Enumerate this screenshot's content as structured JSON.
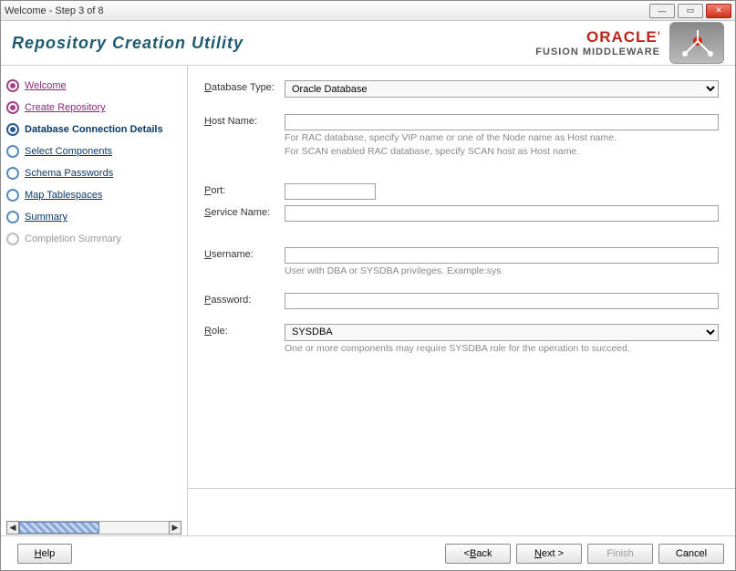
{
  "window": {
    "title": "Welcome - Step 3 of 8"
  },
  "header": {
    "title": "Repository Creation Utility",
    "brand": "ORACLE",
    "brand_sub": "FUSION MIDDLEWARE"
  },
  "steps": [
    {
      "label": "Welcome",
      "state": "done"
    },
    {
      "label": "Create Repository",
      "state": "done"
    },
    {
      "label": "Database Connection Details",
      "state": "current"
    },
    {
      "label": "Select Components",
      "state": "pending"
    },
    {
      "label": "Schema Passwords",
      "state": "pending"
    },
    {
      "label": "Map Tablespaces",
      "state": "pending"
    },
    {
      "label": "Summary",
      "state": "pending"
    },
    {
      "label": "Completion Summary",
      "state": "disabled"
    }
  ],
  "form": {
    "db_type_label": "Database Type:",
    "db_type_value": "Oracle Database",
    "host_label": "Host Name:",
    "host_value": "",
    "host_hint1": "For RAC database, specify VIP name or one of the Node name as Host name.",
    "host_hint2": "For SCAN enabled RAC database, specify SCAN host as Host name.",
    "port_label": "Port:",
    "port_value": "",
    "service_label": "Service Name:",
    "service_value": "",
    "username_label": "Username:",
    "username_value": "",
    "username_hint": "User with DBA or SYSDBA privileges. Example:sys",
    "password_label": "Password:",
    "password_value": "",
    "role_label": "Role:",
    "role_value": "SYSDBA",
    "role_hint": "One or more components may require SYSDBA role for the operation to succeed."
  },
  "buttons": {
    "help": "Help",
    "back": "Back",
    "next": "Next",
    "finish": "Finish",
    "cancel": "Cancel"
  }
}
